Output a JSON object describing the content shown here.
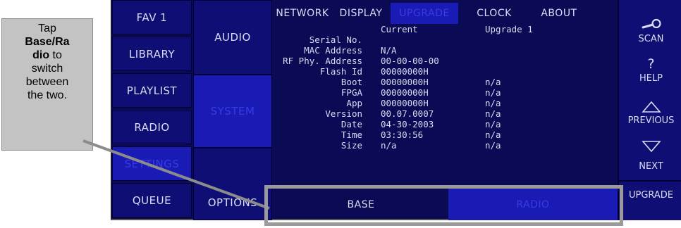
{
  "callout": {
    "line1": "Tap",
    "bold1": "Base/Ra",
    "bold2": "dio",
    "line3": " to",
    "line4": "switch",
    "line5": "between",
    "line6": "the two."
  },
  "nav_primary": [
    {
      "label": "FAV 1"
    },
    {
      "label": "LIBRARY"
    },
    {
      "label": "PLAYLIST"
    },
    {
      "label": "RADIO"
    },
    {
      "label": "SETTINGS"
    },
    {
      "label": "QUEUE"
    }
  ],
  "nav_secondary": [
    {
      "label": "AUDIO"
    },
    {
      "label": "SYSTEM"
    },
    {
      "label": "OPTIONS"
    }
  ],
  "tabs": [
    {
      "label": "NETWORK"
    },
    {
      "label": "DISPLAY"
    },
    {
      "label": "UPGRADE"
    },
    {
      "label": "CLOCK"
    },
    {
      "label": "ABOUT"
    }
  ],
  "info": {
    "col_current": "Current",
    "col_upgrade": "Upgrade 1",
    "rows": [
      {
        "label": "Serial No.",
        "current": "",
        "upgrade": ""
      },
      {
        "label": "MAC Address",
        "current": "N/A",
        "upgrade": ""
      },
      {
        "label": "RF Phy. Address",
        "current": "00-00-00-00",
        "upgrade": ""
      },
      {
        "label": "Flash Id",
        "current": "00000000H",
        "upgrade": ""
      },
      {
        "label": "Boot",
        "current": "00000000H",
        "upgrade": "n/a"
      },
      {
        "label": "FPGA",
        "current": "00000000H",
        "upgrade": "n/a"
      },
      {
        "label": "App",
        "current": "00000000H",
        "upgrade": "n/a"
      },
      {
        "label": "Version",
        "current": "00.07.0007",
        "upgrade": "n/a"
      },
      {
        "label": "Date",
        "current": "04-30-2003",
        "upgrade": "n/a"
      },
      {
        "label": "Time",
        "current": "03:30:56",
        "upgrade": "n/a"
      },
      {
        "label": "Size",
        "current": "n/a",
        "upgrade": "n/a"
      }
    ]
  },
  "bottom": {
    "base": "BASE",
    "radio": "RADIO"
  },
  "right": {
    "scan": "SCAN",
    "help_symbol": "?",
    "help": "HELP",
    "previous": "PREVIOUS",
    "next": "NEXT",
    "upgrade": "UPGRADE"
  },
  "colors": {
    "screen_bg": "#0a0a55",
    "button_bg": "#0e0e74",
    "active_bg": "#1a1ab4",
    "active_text": "#3a3ae6",
    "text": "#d9dcf2",
    "callout_bg": "#c3c3c3",
    "highlight": "#9a9a9a"
  }
}
